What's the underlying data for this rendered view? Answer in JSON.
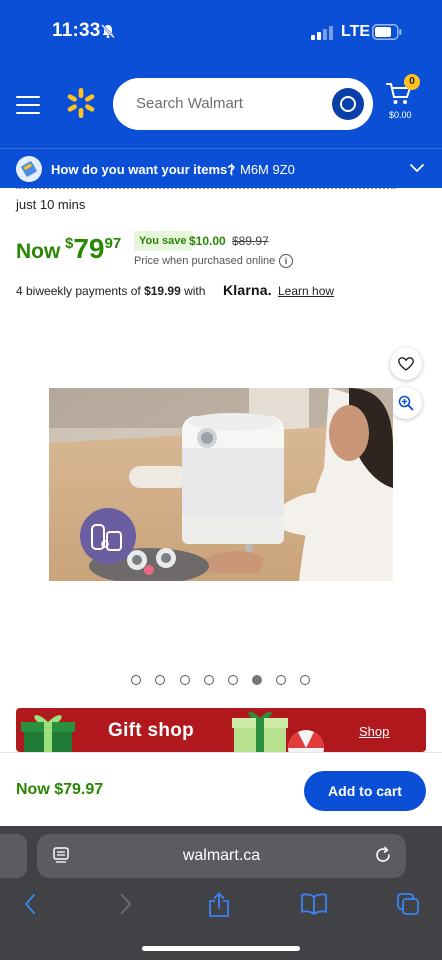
{
  "status_bar": {
    "time": "11:33",
    "network": "LTE"
  },
  "header": {
    "search_placeholder": "Search Walmart",
    "cart_count": "0",
    "cart_total": "$0.00",
    "delivery_prompt": "How do you want your items?",
    "separator": "|",
    "postal_code": "M6M 9Z0",
    "brand_color": "#0a4fd6"
  },
  "product": {
    "subtitle": "just 10 mins",
    "now_label": "Now",
    "price_currency": "$",
    "price_dollars": "79",
    "price_cents": "97",
    "you_save_label": "You save",
    "save_amount": "$10.00",
    "was_price": "$89.97",
    "price_note": "Price when purchased online",
    "klarna_text_1": "4 biweekly payments of ",
    "klarna_amount": "$19.99",
    "klarna_text_2": " with",
    "klarna_brand": "Klarna.",
    "learn_how": "Learn how",
    "price_color": "#2a8703"
  },
  "gallery": {
    "total_images": 8,
    "active_index": 5
  },
  "banner": {
    "title": "Gift shop",
    "link": "Shop",
    "color": "#b0181e"
  },
  "bottom_bar": {
    "price": "Now $79.97",
    "add_to_cart": "Add to cart"
  },
  "browser": {
    "url": "walmart.ca"
  }
}
